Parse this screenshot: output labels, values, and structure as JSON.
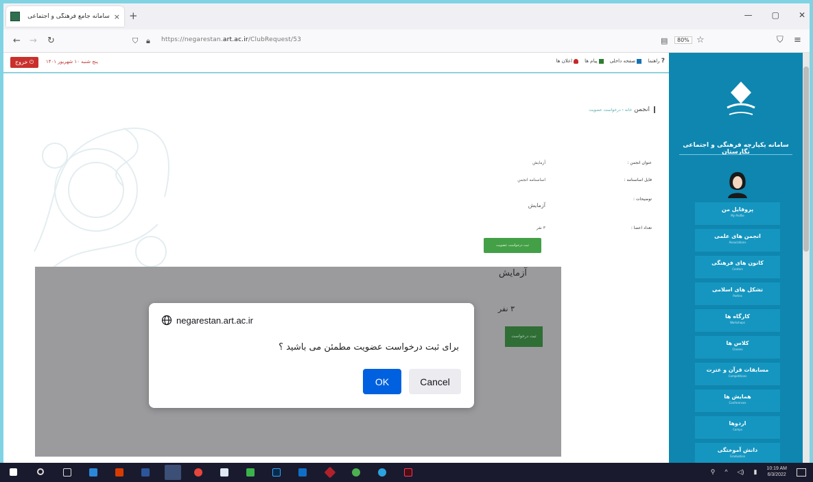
{
  "browser": {
    "tab_title": "سامانه جامع فرهنگی و اجتماعی",
    "tab_close": "×",
    "new_tab": "+",
    "url_prefix": "https://negarestan.",
    "url_domain": "art.ac.ir",
    "url_path": "/ClubRequest/53",
    "zoom": "80%"
  },
  "topbar": {
    "logout_label": "خروج",
    "date_text": "پنج شنبه ۱۰ شهریور ۱۴۰۱",
    "links": [
      "راهنما",
      "صفحه داخلی",
      "پیام ها",
      "اعلان ها"
    ]
  },
  "breadcrumb": {
    "title": "انجمن",
    "sub": "خانه › درخواست عضویت"
  },
  "form": {
    "labels": [
      "عنوان انجمن :",
      "فایل اساسنامه :",
      "توضیحات :",
      "تعداد اعضا :"
    ],
    "values": [
      "آزمایش",
      "اساسنامه انجمن",
      "آزمایش",
      "۳ نفر"
    ],
    "submit": "ثبت درخواست عضویت"
  },
  "sidebar": {
    "brand": "سامانه یکپارچه فرهنگی و اجتماعی نگارستان",
    "menu": [
      {
        "label": "پروفایل من",
        "sub": "My Profile"
      },
      {
        "label": "انجمن های علمی",
        "sub": "Associations"
      },
      {
        "label": "کانون های فرهنگی",
        "sub": "Centers"
      },
      {
        "label": "تشکل های اسلامی",
        "sub": "Parties"
      },
      {
        "label": "کارگاه ها",
        "sub": "Workshops"
      },
      {
        "label": "کلاس ها",
        "sub": "Classes"
      },
      {
        "label": "مسابقات قرآن و عترت",
        "sub": "Competitions"
      },
      {
        "label": "همایش ها",
        "sub": "Conferences"
      },
      {
        "label": "اردوها",
        "sub": "Camps"
      },
      {
        "label": "دانش آموختگی",
        "sub": "Graduation"
      }
    ]
  },
  "overlay": {
    "value1": "آزمایش",
    "value2": "۳ نفر",
    "btn": "ثبت درخواست"
  },
  "dialog": {
    "origin": "negarestan.art.ac.ir",
    "message": "برای ثبت درخواست عضویت مطمئن می باشید ؟",
    "ok": "OK",
    "cancel": "Cancel"
  },
  "taskbar": {
    "time": "10:19 AM",
    "date": "6/3/2022"
  },
  "colors": {
    "sidebar": "#0e86b0",
    "ok_button": "#0061e0",
    "logout": "#c9302c",
    "submit_green": "#43a047"
  }
}
